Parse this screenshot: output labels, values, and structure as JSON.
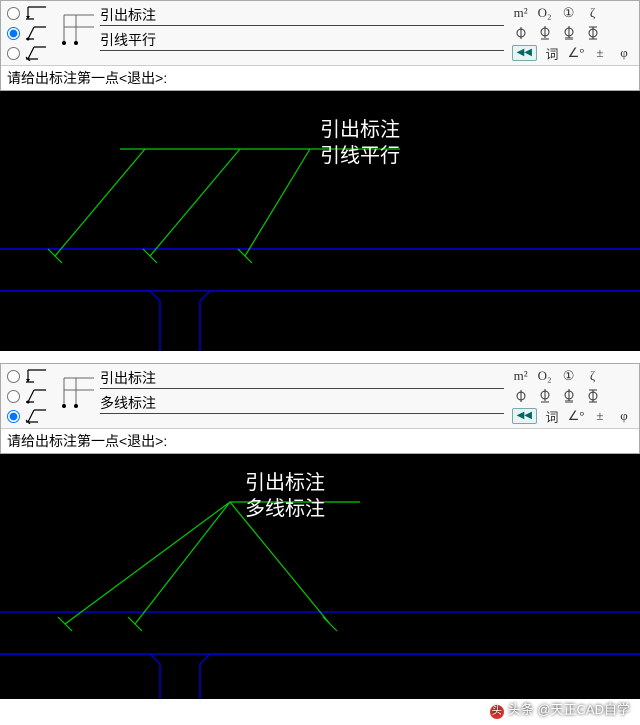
{
  "panel1": {
    "radio_selected": 1,
    "field_top_value": "引出标注",
    "field_bottom_value": "引线平行",
    "prompt": "请给出标注第一点<退出>:"
  },
  "panel2": {
    "radio_selected": 2,
    "field_top_value": "引出标注",
    "field_bottom_value": "多线标注",
    "prompt": "请给出标注第一点<退出>:"
  },
  "symbols": {
    "row1": [
      "m²",
      "O₂",
      "①",
      "ζ"
    ],
    "row2": [
      "Φ",
      "Φ̲",
      "Φ̳",
      "Φ̿"
    ],
    "rewind": "◀◀",
    "row3": [
      "词",
      "∠°",
      "±",
      "φ"
    ]
  },
  "canvas1": {
    "label_top": "引出标注",
    "label_bottom": "引线平行"
  },
  "canvas2": {
    "label_top": "引出标注",
    "label_bottom": "多线标注"
  },
  "watermark": "头条 @天正CAD自学"
}
